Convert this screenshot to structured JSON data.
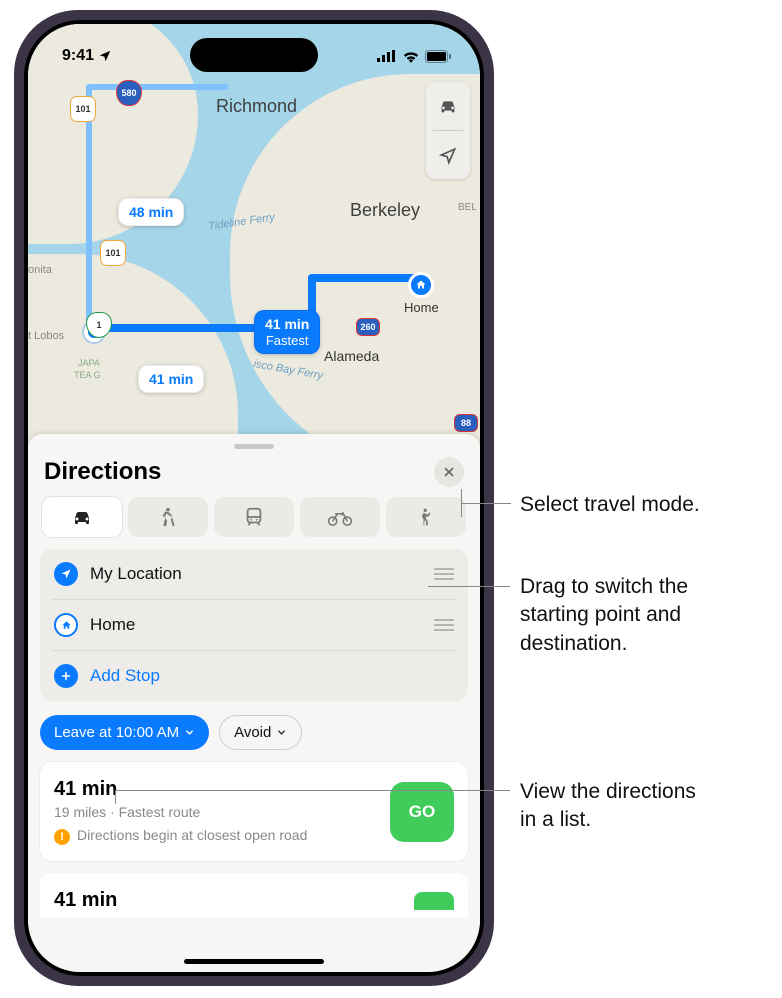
{
  "status": {
    "time": "9:41",
    "loc_icon": "location-arrow"
  },
  "map": {
    "cities": {
      "richmond": "Richmond",
      "berkeley": "Berkeley",
      "alameda": "Alameda",
      "home": "Home",
      "bonita": "onita",
      "lobos": "t Lobos",
      "japa": "JAPA",
      "tea": "TEA G",
      "bel": "BEL"
    },
    "ferry": "Tideline Ferry",
    "bayferry": "isco Bay Ferry",
    "shields": {
      "i101a": "101",
      "i580": "580",
      "i101b": "101",
      "ca1": "1",
      "i260": "260",
      "i880": "88"
    },
    "routes": {
      "alt1": "48 min",
      "alt2": "41 min",
      "primary_time": "41 min",
      "primary_tag": "Fastest"
    }
  },
  "sheet": {
    "title": "Directions",
    "modes": [
      "car",
      "walk",
      "transit",
      "bike",
      "rideshare"
    ],
    "stops": {
      "origin": "My Location",
      "dest": "Home",
      "add": "Add Stop"
    },
    "leave": "Leave at 10:00 AM",
    "avoid": "Avoid",
    "result": {
      "time": "41 min",
      "sub": "19 miles · Fastest route",
      "warn": "Directions begin at closest open road",
      "go": "GO"
    },
    "next_time": "41 min"
  },
  "callouts": {
    "mode": "Select travel mode.",
    "drag1": "Drag to switch the",
    "drag2": "starting point and",
    "drag3": "destination.",
    "list1": "View the directions",
    "list2": "in a list."
  }
}
